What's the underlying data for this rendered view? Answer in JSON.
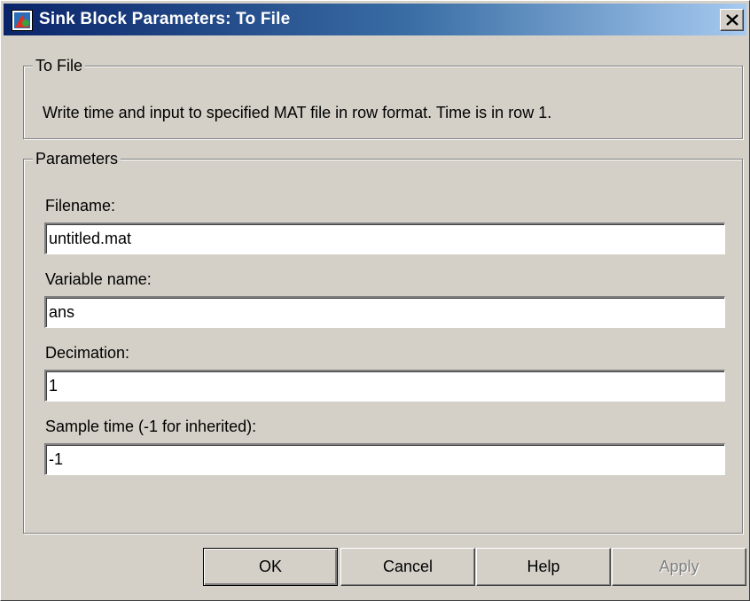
{
  "window": {
    "title": "Sink Block Parameters: To File",
    "icon": "simulink-block-icon",
    "close_icon": "close-icon"
  },
  "block_group": {
    "legend": "To File",
    "description": "Write time and input to specified MAT file in row format.  Time is in row 1."
  },
  "parameters": {
    "legend": "Parameters",
    "fields": [
      {
        "label": "Filename:",
        "value": "untitled.mat"
      },
      {
        "label": "Variable name:",
        "value": "ans"
      },
      {
        "label": "Decimation:",
        "value": "1"
      },
      {
        "label": "Sample time (-1 for inherited):",
        "value": "-1"
      }
    ]
  },
  "buttons": {
    "ok": "OK",
    "cancel": "Cancel",
    "help": "Help",
    "apply": "Apply"
  },
  "colors": {
    "title_gradient_start": "#0a246a",
    "title_gradient_end": "#a6caf0",
    "dialog_face": "#d4d0c8",
    "disabled_text": "#808080"
  }
}
